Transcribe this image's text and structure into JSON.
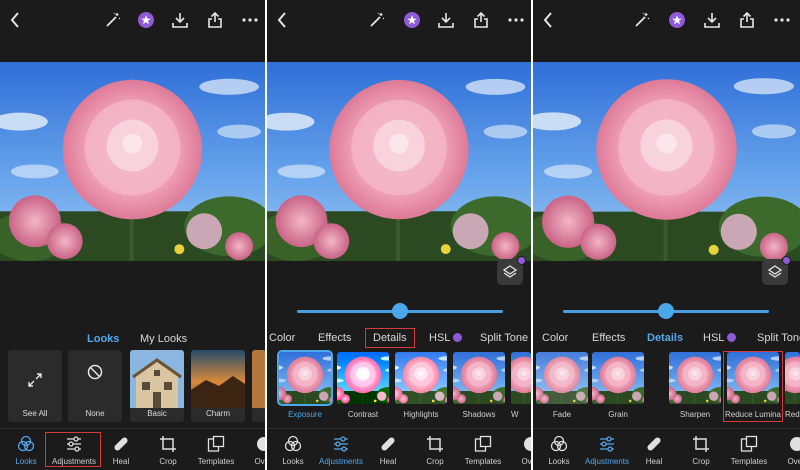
{
  "panels": [
    {
      "tabs": {
        "looks": "Looks",
        "my_looks": "My Looks"
      },
      "looks": [
        {
          "label": "See All"
        },
        {
          "label": "None"
        },
        {
          "label": "Basic"
        },
        {
          "label": "Charm"
        }
      ]
    },
    {
      "tabs": [
        "Color",
        "Effects",
        "Details",
        "HSL",
        "Split Tone"
      ],
      "slider_value": 0.5,
      "thumbs": [
        "Exposure",
        "Contrast",
        "Highlights",
        "Shadows",
        "W"
      ]
    },
    {
      "tabs": [
        "Color",
        "Effects",
        "Details",
        "HSL",
        "Split Tone"
      ],
      "slider_value": 0.5,
      "thumbs": [
        "Fade",
        "Grain",
        "Sharpen",
        "Reduce Lumina",
        "Red"
      ]
    }
  ],
  "bottom_nav": [
    "Looks",
    "Adjustments",
    "Heal",
    "Crop",
    "Templates",
    "Overl"
  ],
  "colors": {
    "accent": "#56a8ec",
    "highlight": "#d33a3a",
    "premium": "#8e5ad9",
    "background": "#1b1b1b"
  }
}
